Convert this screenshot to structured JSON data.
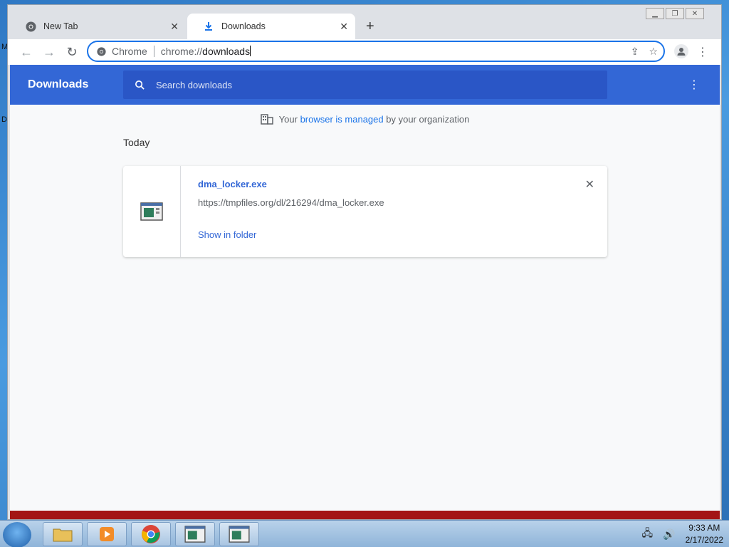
{
  "desktop": {
    "left_letters": [
      "M",
      "D"
    ]
  },
  "browser": {
    "tabs": [
      {
        "label": "New Tab",
        "icon": "chrome-icon"
      },
      {
        "label": "Downloads",
        "icon": "download-icon"
      }
    ],
    "newtab_label": "+",
    "omnibox": {
      "chip": "Chrome",
      "url_prefix": "chrome://",
      "url_main": "downloads"
    }
  },
  "downloads_page": {
    "title": "Downloads",
    "search_placeholder": "Search downloads",
    "managed_prefix": "Your",
    "managed_link": "browser is managed",
    "managed_suffix": "by your organization",
    "section": "Today",
    "items": [
      {
        "filename": "dma_locker.exe",
        "url": "https://tmpfiles.org/dl/216294/dma_locker.exe",
        "action": "Show in folder"
      }
    ]
  },
  "taskbar": {
    "time": "9:33 AM",
    "date": "2/17/2022"
  },
  "colors": {
    "header_blue": "#3367d6",
    "link_blue": "#1a73e8",
    "alert_red": "#a31515"
  }
}
